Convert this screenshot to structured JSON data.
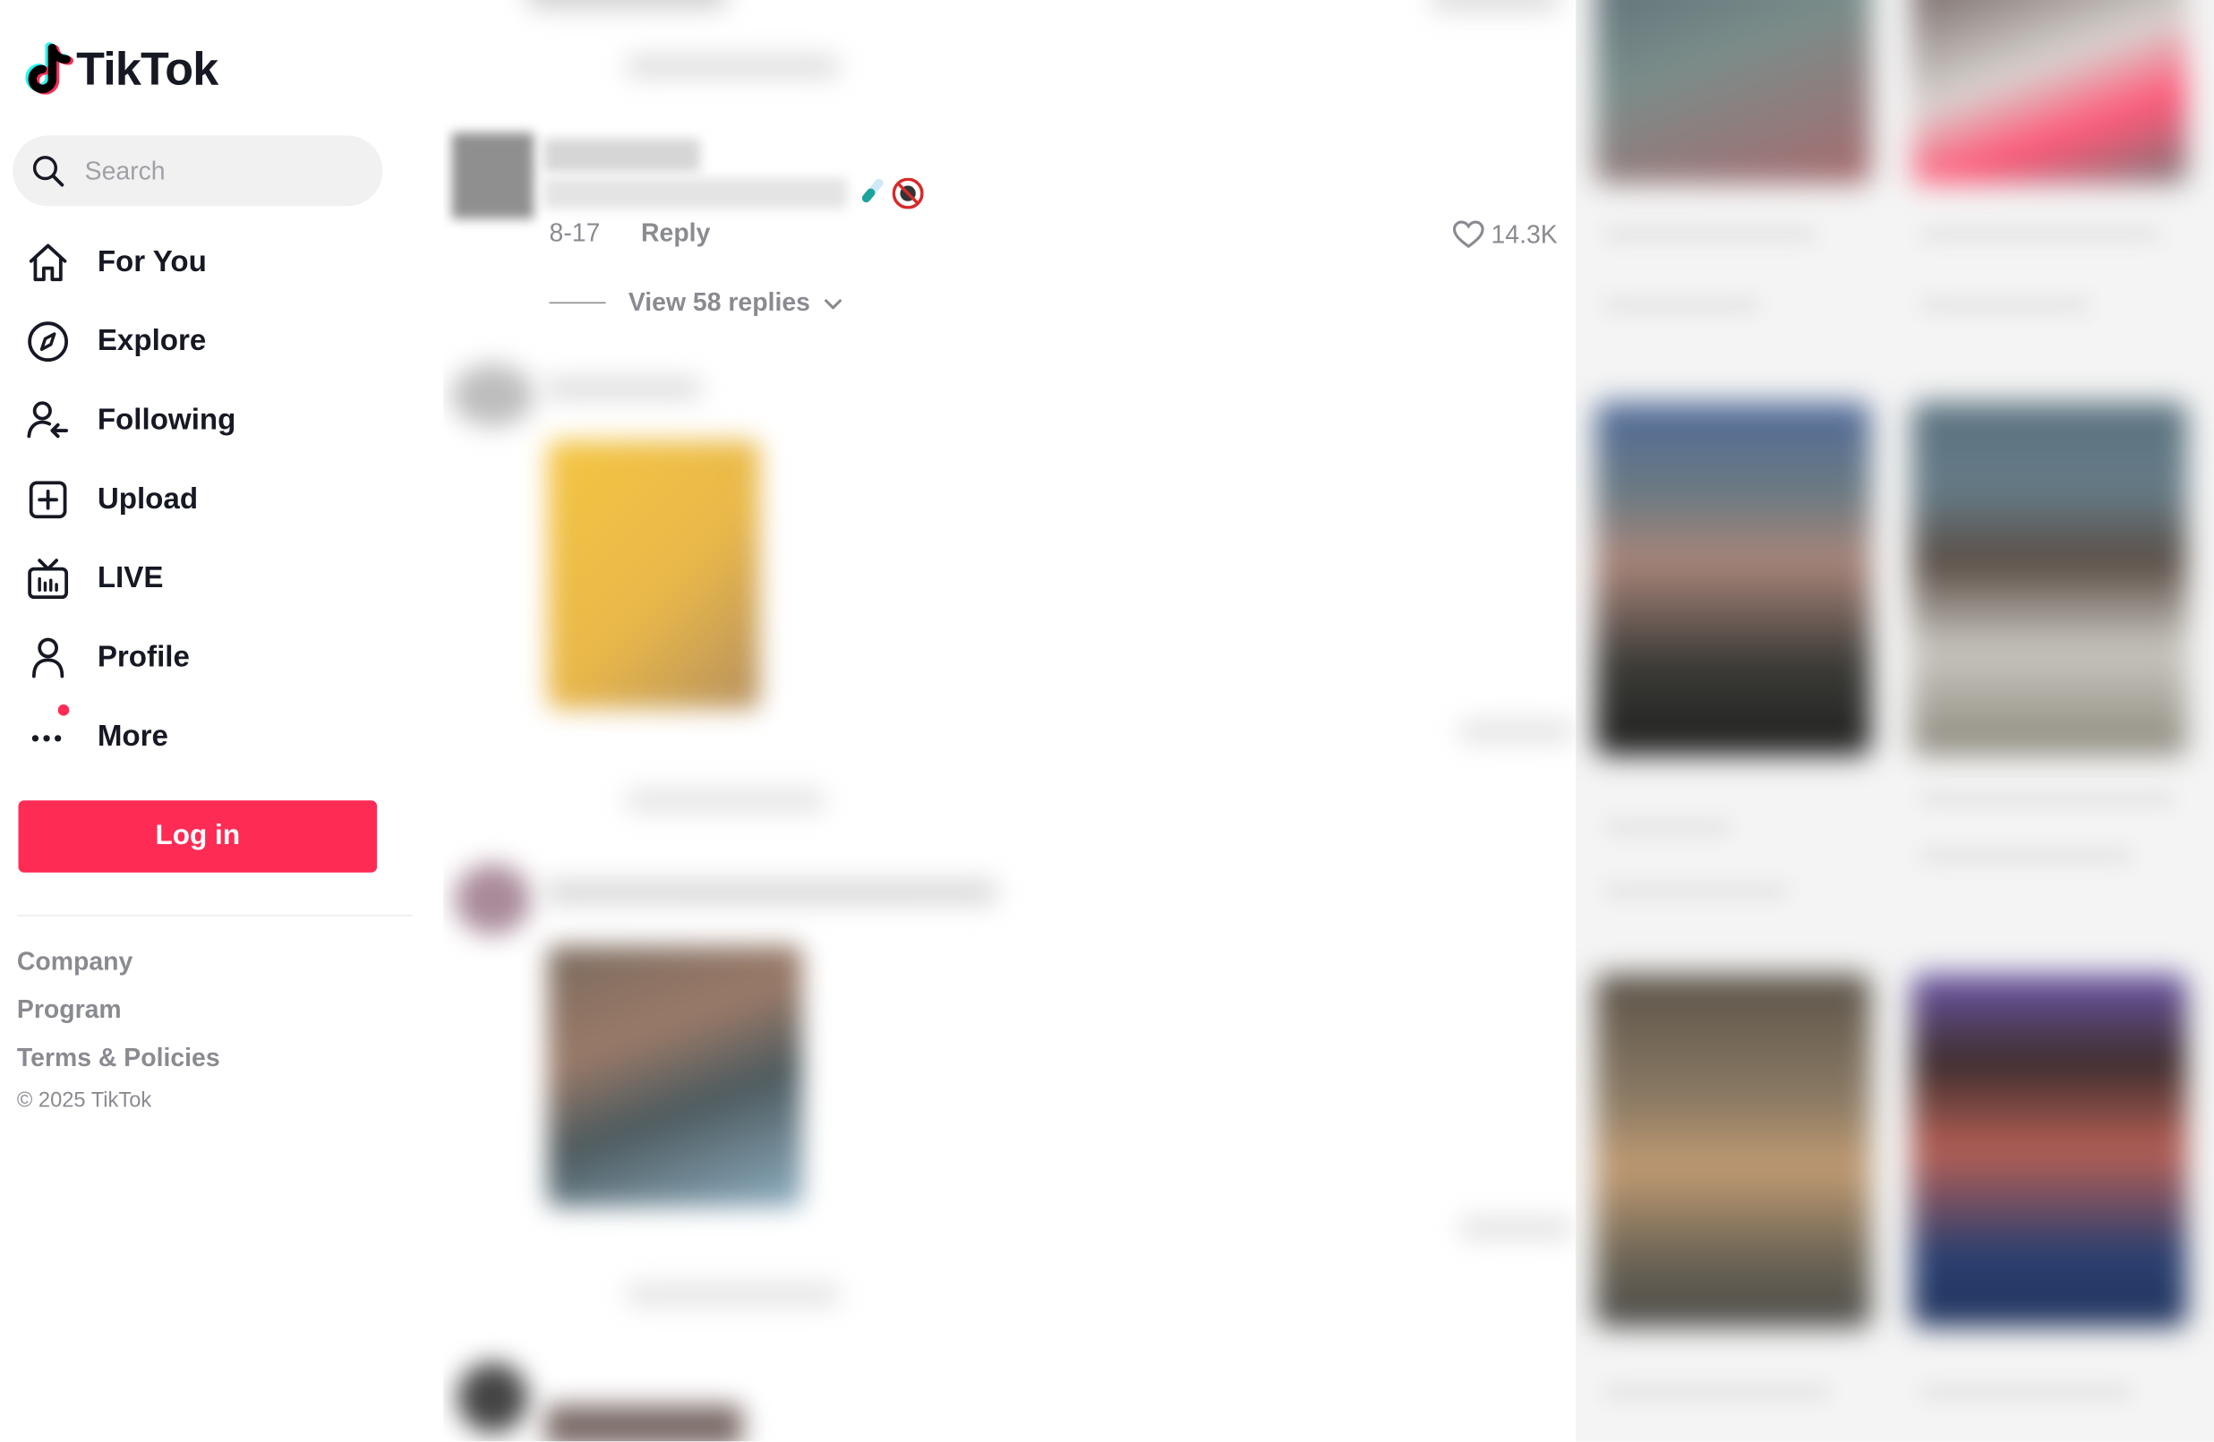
{
  "app": {
    "name": "TikTok"
  },
  "search": {
    "placeholder": "Search"
  },
  "nav": {
    "items": [
      {
        "label": "For You",
        "icon": "home-icon"
      },
      {
        "label": "Explore",
        "icon": "compass-icon"
      },
      {
        "label": "Following",
        "icon": "following-icon"
      },
      {
        "label": "Upload",
        "icon": "plus-square-icon"
      },
      {
        "label": "LIVE",
        "icon": "live-tv-icon"
      },
      {
        "label": "Profile",
        "icon": "person-icon"
      },
      {
        "label": "More",
        "icon": "more-dots-icon",
        "badge": true
      }
    ]
  },
  "login": {
    "label": "Log in"
  },
  "footer": {
    "links": [
      "Company",
      "Program",
      "Terms & Policies"
    ],
    "copyright": "© 2025 TikTok"
  },
  "comment": {
    "date": "8-17",
    "reply_label": "Reply",
    "like_count": "14.3K",
    "view_replies": "View 58 replies",
    "emojis": [
      "test-tube-emoji",
      "no-entry-emoji"
    ]
  },
  "colors": {
    "brand": "#fe2c55",
    "text_primary": "#161823",
    "text_secondary": "#8a8b91",
    "search_bg": "#f1f1f2",
    "logo_cyan": "#25f4ee"
  }
}
